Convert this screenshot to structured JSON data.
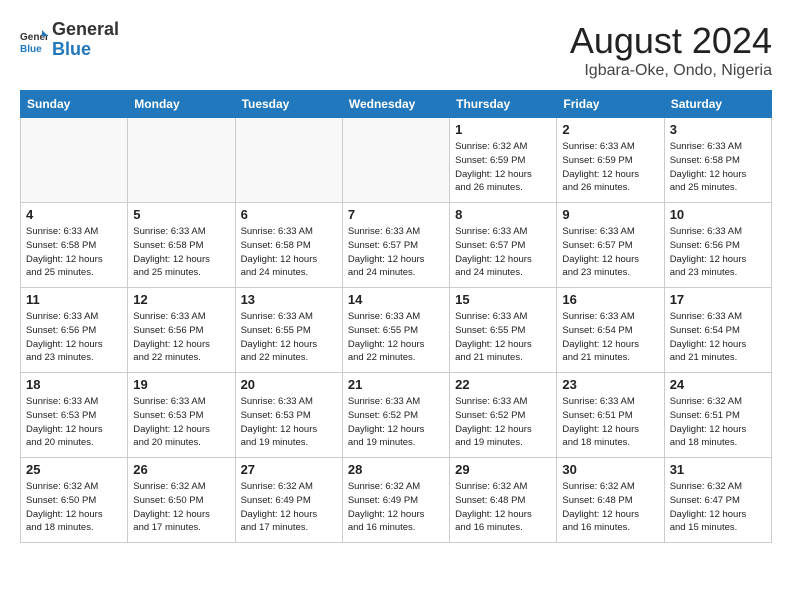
{
  "logo": {
    "general": "General",
    "blue": "Blue"
  },
  "header": {
    "title": "August 2024",
    "subtitle": "Igbara-Oke, Ondo, Nigeria"
  },
  "weekdays": [
    "Sunday",
    "Monday",
    "Tuesday",
    "Wednesday",
    "Thursday",
    "Friday",
    "Saturday"
  ],
  "weeks": [
    [
      {
        "day": "",
        "empty": true
      },
      {
        "day": "",
        "empty": true
      },
      {
        "day": "",
        "empty": true
      },
      {
        "day": "",
        "empty": true
      },
      {
        "day": "1",
        "info": "Sunrise: 6:32 AM\nSunset: 6:59 PM\nDaylight: 12 hours\nand 26 minutes."
      },
      {
        "day": "2",
        "info": "Sunrise: 6:33 AM\nSunset: 6:59 PM\nDaylight: 12 hours\nand 26 minutes."
      },
      {
        "day": "3",
        "info": "Sunrise: 6:33 AM\nSunset: 6:58 PM\nDaylight: 12 hours\nand 25 minutes."
      }
    ],
    [
      {
        "day": "4",
        "info": "Sunrise: 6:33 AM\nSunset: 6:58 PM\nDaylight: 12 hours\nand 25 minutes."
      },
      {
        "day": "5",
        "info": "Sunrise: 6:33 AM\nSunset: 6:58 PM\nDaylight: 12 hours\nand 25 minutes."
      },
      {
        "day": "6",
        "info": "Sunrise: 6:33 AM\nSunset: 6:58 PM\nDaylight: 12 hours\nand 24 minutes."
      },
      {
        "day": "7",
        "info": "Sunrise: 6:33 AM\nSunset: 6:57 PM\nDaylight: 12 hours\nand 24 minutes."
      },
      {
        "day": "8",
        "info": "Sunrise: 6:33 AM\nSunset: 6:57 PM\nDaylight: 12 hours\nand 24 minutes."
      },
      {
        "day": "9",
        "info": "Sunrise: 6:33 AM\nSunset: 6:57 PM\nDaylight: 12 hours\nand 23 minutes."
      },
      {
        "day": "10",
        "info": "Sunrise: 6:33 AM\nSunset: 6:56 PM\nDaylight: 12 hours\nand 23 minutes."
      }
    ],
    [
      {
        "day": "11",
        "info": "Sunrise: 6:33 AM\nSunset: 6:56 PM\nDaylight: 12 hours\nand 23 minutes."
      },
      {
        "day": "12",
        "info": "Sunrise: 6:33 AM\nSunset: 6:56 PM\nDaylight: 12 hours\nand 22 minutes."
      },
      {
        "day": "13",
        "info": "Sunrise: 6:33 AM\nSunset: 6:55 PM\nDaylight: 12 hours\nand 22 minutes."
      },
      {
        "day": "14",
        "info": "Sunrise: 6:33 AM\nSunset: 6:55 PM\nDaylight: 12 hours\nand 22 minutes."
      },
      {
        "day": "15",
        "info": "Sunrise: 6:33 AM\nSunset: 6:55 PM\nDaylight: 12 hours\nand 21 minutes."
      },
      {
        "day": "16",
        "info": "Sunrise: 6:33 AM\nSunset: 6:54 PM\nDaylight: 12 hours\nand 21 minutes."
      },
      {
        "day": "17",
        "info": "Sunrise: 6:33 AM\nSunset: 6:54 PM\nDaylight: 12 hours\nand 21 minutes."
      }
    ],
    [
      {
        "day": "18",
        "info": "Sunrise: 6:33 AM\nSunset: 6:53 PM\nDaylight: 12 hours\nand 20 minutes."
      },
      {
        "day": "19",
        "info": "Sunrise: 6:33 AM\nSunset: 6:53 PM\nDaylight: 12 hours\nand 20 minutes."
      },
      {
        "day": "20",
        "info": "Sunrise: 6:33 AM\nSunset: 6:53 PM\nDaylight: 12 hours\nand 19 minutes."
      },
      {
        "day": "21",
        "info": "Sunrise: 6:33 AM\nSunset: 6:52 PM\nDaylight: 12 hours\nand 19 minutes."
      },
      {
        "day": "22",
        "info": "Sunrise: 6:33 AM\nSunset: 6:52 PM\nDaylight: 12 hours\nand 19 minutes."
      },
      {
        "day": "23",
        "info": "Sunrise: 6:33 AM\nSunset: 6:51 PM\nDaylight: 12 hours\nand 18 minutes."
      },
      {
        "day": "24",
        "info": "Sunrise: 6:32 AM\nSunset: 6:51 PM\nDaylight: 12 hours\nand 18 minutes."
      }
    ],
    [
      {
        "day": "25",
        "info": "Sunrise: 6:32 AM\nSunset: 6:50 PM\nDaylight: 12 hours\nand 18 minutes."
      },
      {
        "day": "26",
        "info": "Sunrise: 6:32 AM\nSunset: 6:50 PM\nDaylight: 12 hours\nand 17 minutes."
      },
      {
        "day": "27",
        "info": "Sunrise: 6:32 AM\nSunset: 6:49 PM\nDaylight: 12 hours\nand 17 minutes."
      },
      {
        "day": "28",
        "info": "Sunrise: 6:32 AM\nSunset: 6:49 PM\nDaylight: 12 hours\nand 16 minutes."
      },
      {
        "day": "29",
        "info": "Sunrise: 6:32 AM\nSunset: 6:48 PM\nDaylight: 12 hours\nand 16 minutes."
      },
      {
        "day": "30",
        "info": "Sunrise: 6:32 AM\nSunset: 6:48 PM\nDaylight: 12 hours\nand 16 minutes."
      },
      {
        "day": "31",
        "info": "Sunrise: 6:32 AM\nSunset: 6:47 PM\nDaylight: 12 hours\nand 15 minutes."
      }
    ]
  ]
}
